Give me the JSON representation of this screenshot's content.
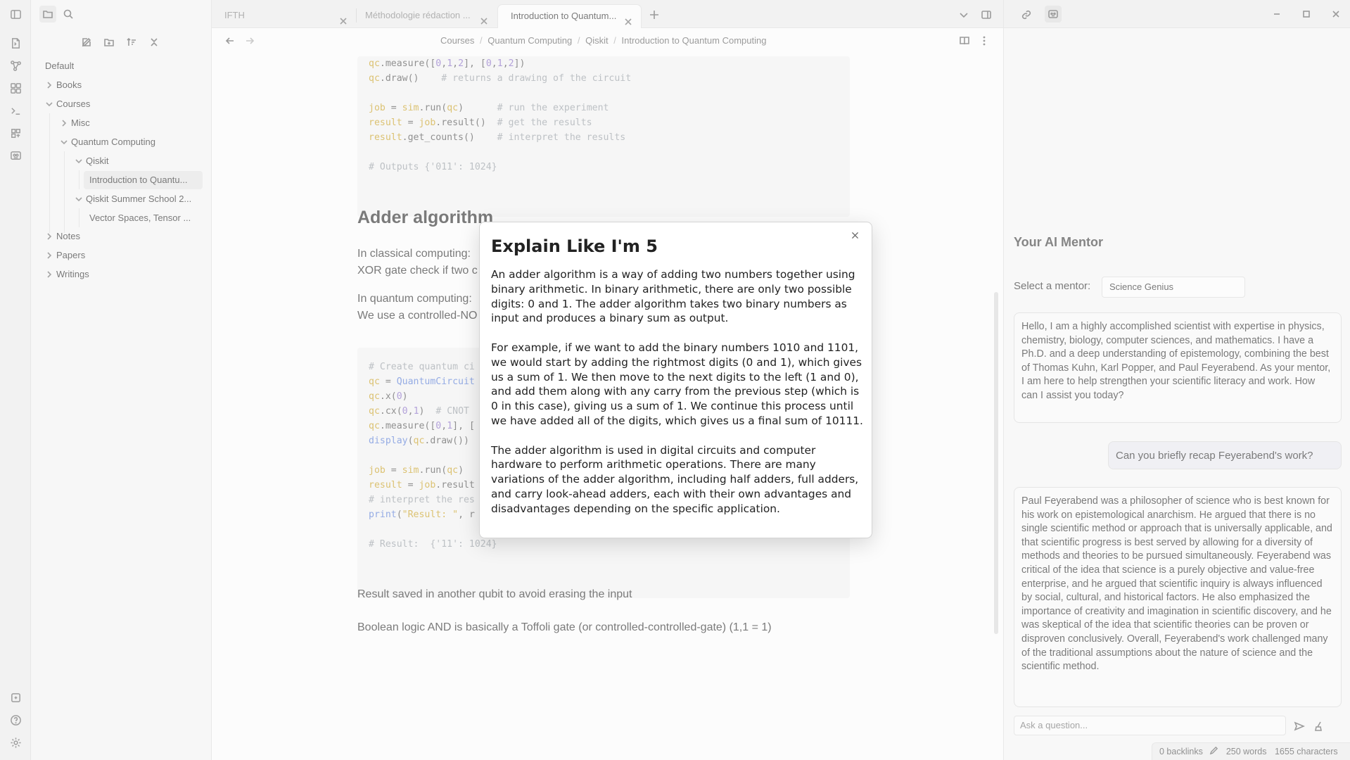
{
  "tabs": [
    {
      "label": "IFTH",
      "active": false
    },
    {
      "label": "Méthodologie rédaction ...",
      "active": false
    },
    {
      "label": "Introduction to Quantum...",
      "active": true
    }
  ],
  "breadcrumb": [
    "Courses",
    "Quantum Computing",
    "Qiskit",
    "Introduction to Quantum Computing"
  ],
  "breadcrumb_sep": "/",
  "sidebar": {
    "vault": "Default",
    "items": [
      {
        "label": "Books"
      },
      {
        "label": "Courses"
      },
      {
        "label": "Misc"
      },
      {
        "label": "Quantum Computing"
      },
      {
        "label": "Qiskit"
      },
      {
        "label": "Introduction to Quantu..."
      },
      {
        "label": "Qiskit Summer School 2..."
      },
      {
        "label": "Vector Spaces, Tensor ..."
      },
      {
        "label": "Notes"
      },
      {
        "label": "Papers"
      },
      {
        "label": "Writings"
      }
    ]
  },
  "editor": {
    "heading": "Adder algorithm",
    "para1_l1": "In classical computing:",
    "para1_l2": "XOR gate check if two c",
    "para2_l1": "In quantum computing:",
    "para2_l2": "We use a controlled-NO",
    "after1": "Result saved in another qubit to avoid erasing the input",
    "after2": "Boolean logic AND is basically a Toffoli gate (or controlled-controlled-gate) (1,1 = 1)"
  },
  "modal": {
    "title": "Explain Like I'm 5",
    "p1": "An adder algorithm is a way of adding two numbers together using binary arithmetic. In binary arithmetic, there are only two possible digits: 0 and 1. The adder algorithm takes two binary numbers as input and produces a binary sum as output.",
    "p2": "For example, if we want to add the binary numbers 1010 and 1101, we would start by adding the rightmost digits (0 and 1), which gives us a sum of 1. We then move to the next digits to the left (1 and 0), and add them along with any carry from the previous step (which is 0 in this case), giving us a sum of 1. We continue this process until we have added all of the digits, which gives us a final sum of 10111.",
    "p3": "The adder algorithm is used in digital circuits and computer hardware to perform arithmetic operations. There are many variations of the adder algorithm, including half adders, full adders, and carry look-ahead adders, each with their own advantages and disadvantages depending on the specific application."
  },
  "mentor": {
    "title": "Your AI Mentor",
    "select_label": "Select a mentor:",
    "selected": "Science Genius",
    "messages": [
      {
        "role": "assistant",
        "text": "Hello, I am a highly accomplished scientist with expertise in physics, chemistry, biology, computer sciences, and mathematics. I have a Ph.D. and a deep understanding of epistemology, combining the best of Thomas Kuhn, Karl Popper, and Paul Feyerabend. As your mentor, I am here to help strengthen your scientific literacy and work. How can I assist you today?"
      },
      {
        "role": "user",
        "text": "Can you briefly recap Feyerabend's work?"
      },
      {
        "role": "assistant",
        "text": "Paul Feyerabend was a philosopher of science who is best known for his work on epistemological anarchism. He argued that there is no single scientific method or approach that is universally applicable, and that scientific progress is best served by allowing for a diversity of methods and theories to be pursued simultaneously. Feyerabend was critical of the idea that science is a purely objective and value-free enterprise, and he argued that scientific inquiry is always influenced by social, cultural, and historical factors. He also emphasized the importance of creativity and imagination in scientific discovery, and he was skeptical of the idea that scientific theories can be proven or disproven conclusively. Overall, Feyerabend's work challenged many of the traditional assumptions about the nature of science and the scientific method."
      }
    ],
    "input_placeholder": "Ask a question..."
  },
  "status": {
    "backlinks": "0 backlinks",
    "words": "250 words",
    "chars": "1655 characters"
  }
}
